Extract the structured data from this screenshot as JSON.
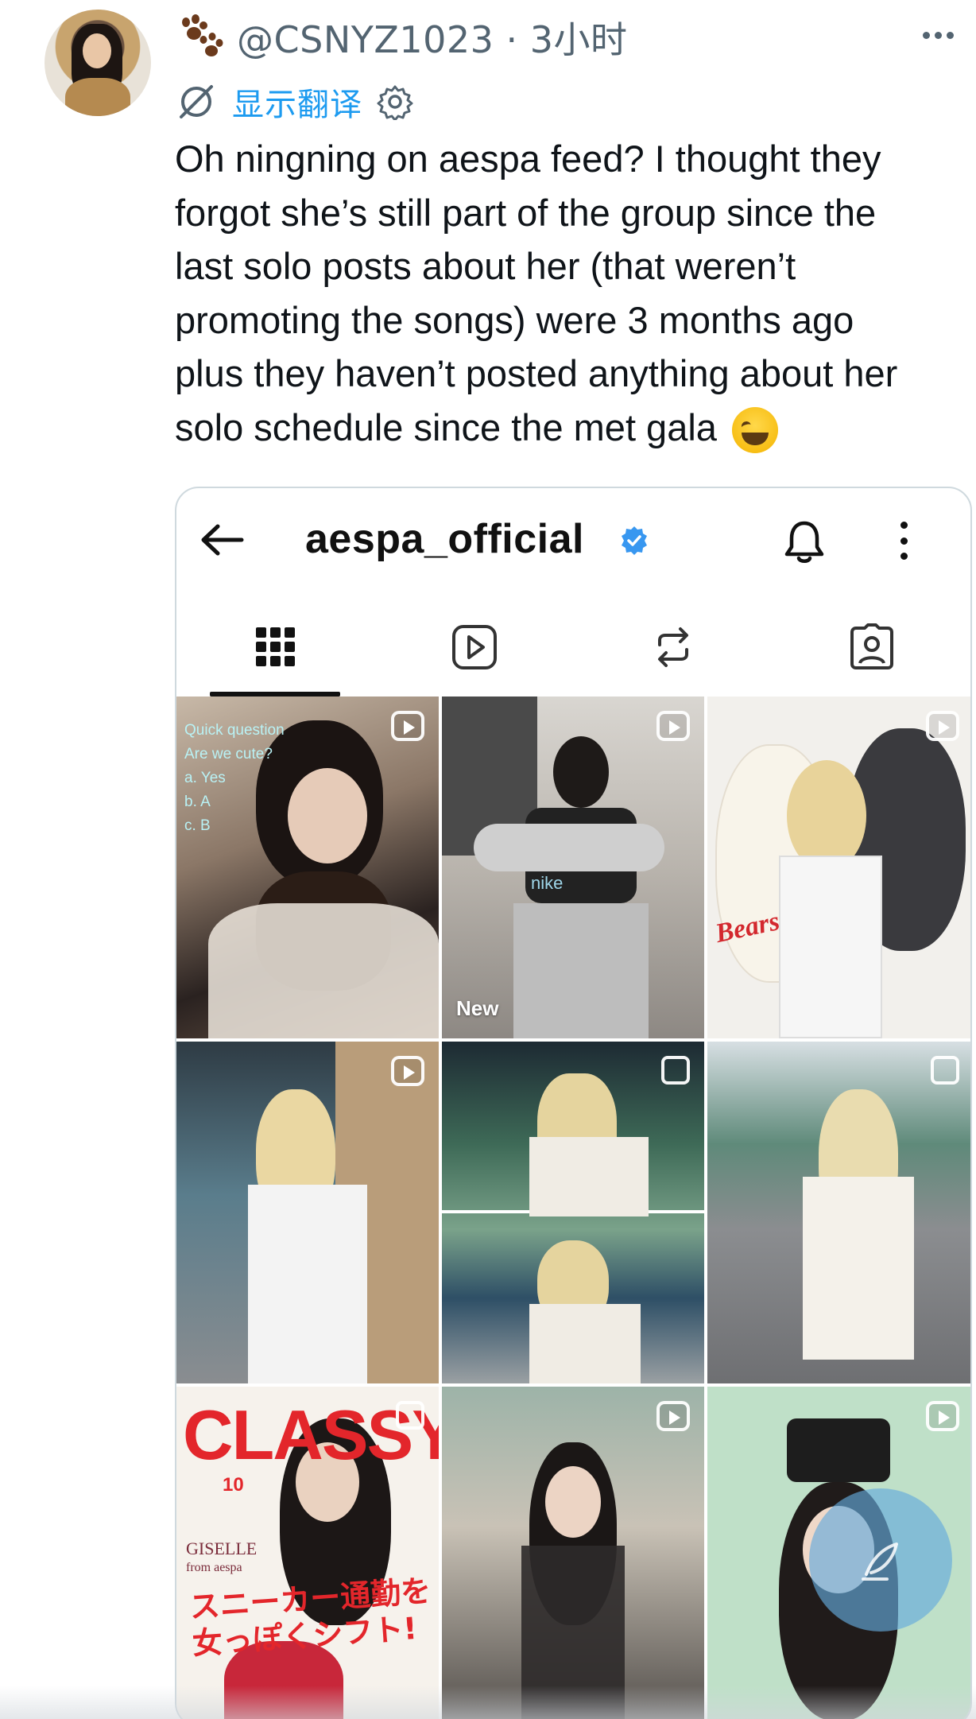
{
  "tweet": {
    "handle": "@CSNYZ1023",
    "separator": "·",
    "time": "3小时",
    "translate_label": "显示翻译",
    "text_lines": [
      "Oh ningning on aespa feed? I thought they",
      "forgot she’s still part of the group since the",
      "last solo posts about her (that weren’t",
      "promoting the songs) were 3 months ago",
      "plus they haven’t posted anything about her",
      "solo schedule since the met gala"
    ],
    "emoji": "grinning-squinting-face"
  },
  "instagram": {
    "username": "aespa_official",
    "verified": true,
    "tabs": [
      "grid-icon",
      "reels-icon",
      "tagged-reposts-icon",
      "tagged-user-icon"
    ],
    "active_tab": "grid-icon",
    "posts": [
      {
        "type": "reel",
        "overlay_lines": [
          "Quick question",
          "Are we cute?",
          "a. Yes",
          "b. A",
          "c. B"
        ]
      },
      {
        "type": "reel",
        "labels": [
          "nike",
          "New"
        ]
      },
      {
        "type": "reel",
        "labels": [
          "Bears"
        ]
      },
      {
        "type": "reel"
      },
      {
        "type": "carousel"
      },
      {
        "type": "carousel"
      },
      {
        "type": "carousel",
        "magazine_title": "CLASSY.",
        "magazine_issue": "10",
        "cover_name": "GISELLE",
        "cover_sub": "from aespa",
        "cover_headline": [
          "スニーカー通勤を",
          "女っぽくシフト!"
        ]
      },
      {
        "type": "reel"
      },
      {
        "type": "reel"
      }
    ]
  },
  "colors": {
    "link": "#1d9bf0",
    "secondary_text": "#536471",
    "primary_text": "#0f1419",
    "verified_badge": "#3897f0"
  }
}
